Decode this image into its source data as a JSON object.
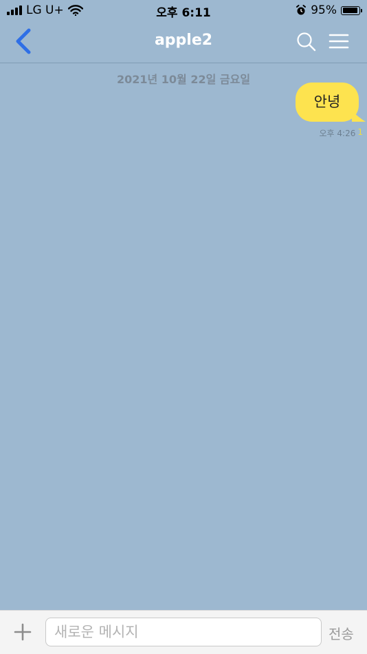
{
  "status_bar": {
    "carrier": "LG U+",
    "time": "오후 6:11",
    "battery_percent": "95%",
    "battery_level": 0.95,
    "icons": [
      "signal-icon",
      "wifi-icon",
      "alarm-icon",
      "battery-icon"
    ]
  },
  "nav": {
    "title": "apple2",
    "back_icon": "chevron-left-icon",
    "search_icon": "search-icon",
    "menu_icon": "hamburger-menu-icon"
  },
  "chat": {
    "date_divider": "2021년 10월 22일 금요일",
    "messages": [
      {
        "text": "안녕",
        "time": "오후 4:26",
        "unread": "1",
        "sender": "me"
      }
    ]
  },
  "input_bar": {
    "add_icon": "plus-icon",
    "placeholder": "새로운 메시지",
    "value": "",
    "send_label": "전송"
  },
  "colors": {
    "background": "#9db8d0",
    "bubble": "#fde34f",
    "back_arrow": "#2f6fe6"
  }
}
